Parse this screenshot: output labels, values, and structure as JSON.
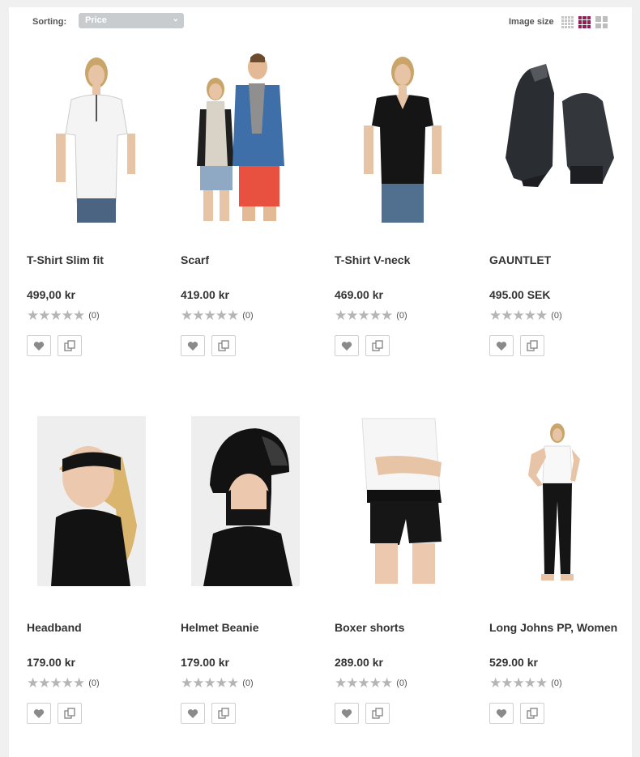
{
  "toolbar": {
    "sorting_label": "Sorting:",
    "sorting_value": "Price",
    "image_size_label": "Image size"
  },
  "products": [
    {
      "name": "T-Shirt Slim fit",
      "price": "499,00 kr",
      "rating_count": "(0)",
      "rating": 0
    },
    {
      "name": "Scarf",
      "price": "419.00 kr",
      "rating_count": "(0)",
      "rating": 0
    },
    {
      "name": "T-Shirt V-neck",
      "price": "469.00 kr",
      "rating_count": "(0)",
      "rating": 0
    },
    {
      "name": "GAUNTLET",
      "price": "495.00 SEK",
      "rating_count": "(0)",
      "rating": 0
    },
    {
      "name": "Headband",
      "price": "179.00 kr",
      "rating_count": "(0)",
      "rating": 0
    },
    {
      "name": "Helmet Beanie",
      "price": "179.00 kr",
      "rating_count": "(0)",
      "rating": 0
    },
    {
      "name": "Boxer shorts",
      "price": "289.00 kr",
      "rating_count": "(0)",
      "rating": 0
    },
    {
      "name": "Long Johns PP, Women",
      "price": "529.00 kr",
      "rating_count": "(0)",
      "rating": 0
    }
  ],
  "icons": {
    "wishlist": "heart-icon",
    "compare": "compare-icon",
    "dropdown": "chevron-down-icon"
  },
  "colors": {
    "accent": "#9b1a5c",
    "star_empty": "#b5b5b5",
    "select_bg": "#c9ccce"
  }
}
